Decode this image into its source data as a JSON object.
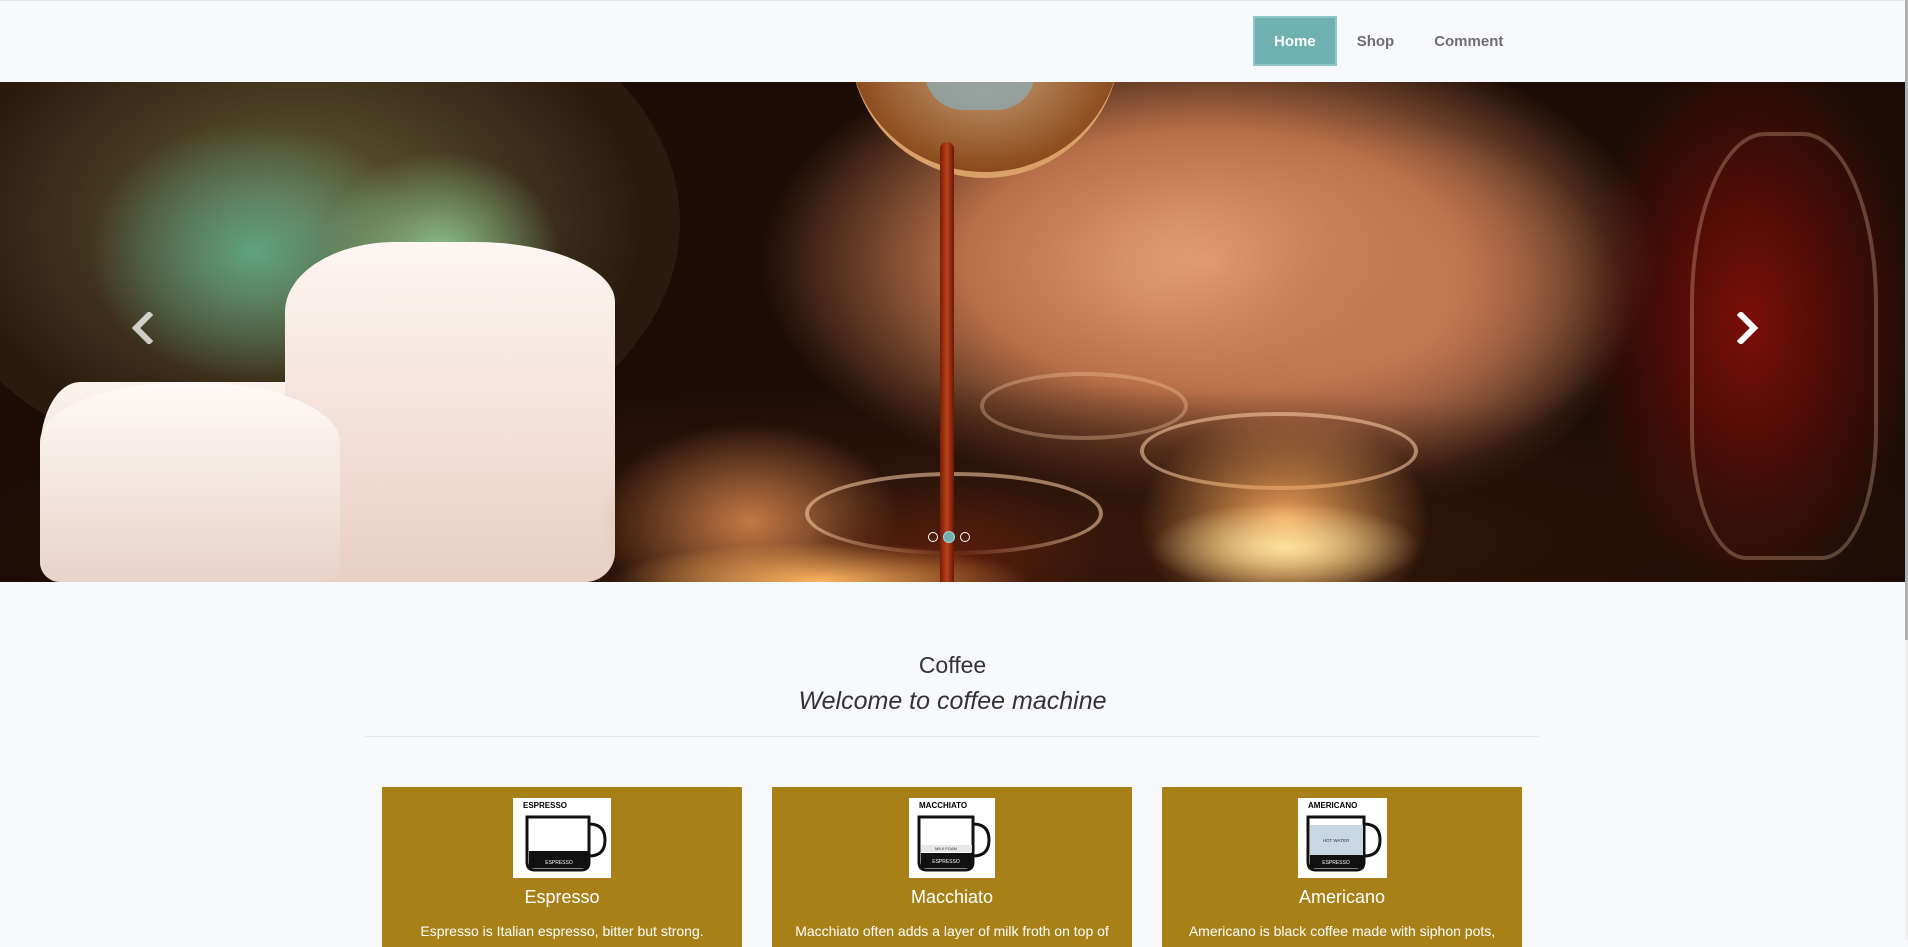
{
  "nav": {
    "items": [
      {
        "label": "Home",
        "active": true
      },
      {
        "label": "Shop",
        "active": false
      },
      {
        "label": "Comment",
        "active": false
      }
    ]
  },
  "carousel": {
    "prev_icon": "chevron-left-icon",
    "next_icon": "chevron-right-icon",
    "slide_count": 3,
    "active_slide": 2
  },
  "heading": {
    "title": "Coffee",
    "subtitle": "Welcome to coffee machine"
  },
  "cards": [
    {
      "name": "Espresso",
      "image_label": "ESPRESSO",
      "layers": [
        "ESPRESSO"
      ],
      "description": "Espresso is Italian espresso, bitter but strong."
    },
    {
      "name": "Macchiato",
      "image_label": "MACCHIATO",
      "layers": [
        "MILK FOAM",
        "ESPRESSO"
      ],
      "description": "Macchiato often adds a layer of milk froth on top of"
    },
    {
      "name": "Americano",
      "image_label": "AMERICANO",
      "layers": [
        "HOT WATER",
        "ESPRESSO"
      ],
      "description": "Americano is black coffee made with siphon pots,"
    }
  ],
  "colors": {
    "accent": "#6fb1b1",
    "card_background": "#a78118",
    "page_background": "#f8f9fd"
  }
}
